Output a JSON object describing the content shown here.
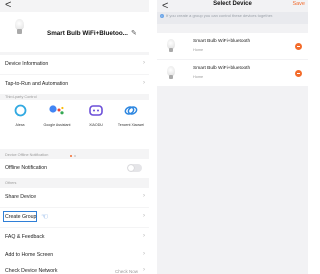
{
  "left_screen": {
    "back_glyph": "<",
    "device_name": "Smart Bulb WiFi+Bluetoo...",
    "menu_top": [
      {
        "label": "Device Information"
      },
      {
        "label": "Tap-to-Run and Automation"
      }
    ],
    "third_party_title": "Third-party Control",
    "third_party": [
      {
        "label": "Alexa",
        "icon": "alexa-icon"
      },
      {
        "label": "Google Assistant",
        "icon": "google-assistant-icon"
      },
      {
        "label": "XIAODU",
        "icon": "xiaodu-icon"
      },
      {
        "label": "Tencent Xiaowei",
        "icon": "tencent-xiaowei-icon"
      }
    ],
    "offline_section_title": "Device Offline Notification",
    "offline_notification_label": "Offline Notification",
    "offline_notification_enabled": false,
    "others_title": "Others",
    "share_device_label": "Share Device",
    "create_group_label": "Create Group",
    "faq_label": "FAQ & Feedback",
    "add_home_label": "Add to Home Screen",
    "check_network_label": "Check Device Network",
    "check_network_value": "Check Now"
  },
  "right_screen": {
    "back_glyph": "<",
    "title": "Select Device",
    "save_label": "Save",
    "hint": "If you create a group you can control these devices together.",
    "devices": [
      {
        "name": "Smart Bulb WiFi+bluetooth",
        "room": "Home"
      },
      {
        "name": "Smart Bulb WiFi+bluetooth",
        "room": "Home"
      }
    ]
  },
  "colors": {
    "accent": "#f26b2d",
    "highlight_box": "#2f7fd7",
    "background": "#f4f4f5"
  }
}
